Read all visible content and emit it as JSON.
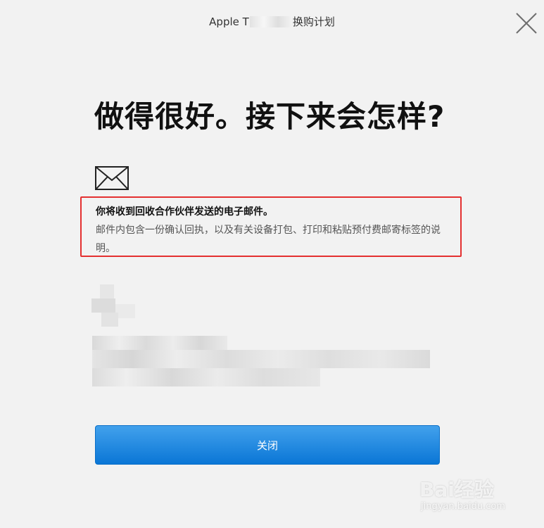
{
  "header": {
    "title_prefix": "Apple T",
    "title_suffix": "换购计划"
  },
  "main": {
    "headline": "做得很好。接下来会怎样?",
    "info": {
      "title": "你将收到回收合作伙伴发送的电子邮件。",
      "body": "邮件内包含一份确认回执，以及有关设备打包、打印和粘贴预付费邮寄标签的说明。"
    }
  },
  "footer": {
    "close_label": "关闭"
  },
  "watermark": {
    "text": "Bai经验",
    "url": "jingyan.baidu.com"
  },
  "icons": {
    "close": "close-x-icon",
    "mail": "envelope-icon"
  },
  "colors": {
    "button_top": "#42a1ec",
    "button_bottom": "#0a76d6",
    "highlight_border": "#e43030",
    "background": "#f2f2f2"
  }
}
